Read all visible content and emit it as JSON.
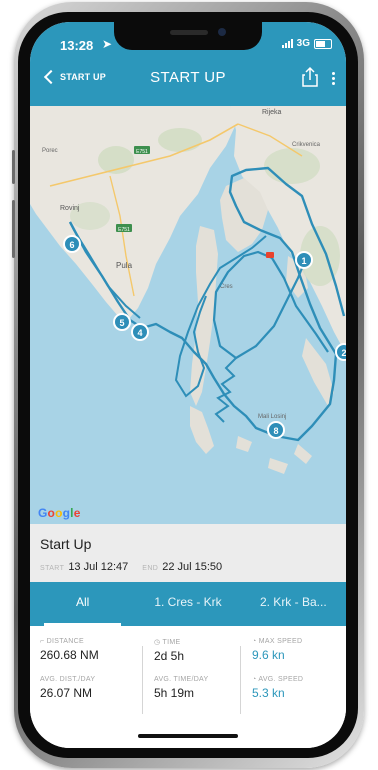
{
  "status": {
    "time": "13:28",
    "signal_label": "3G"
  },
  "header": {
    "back_label": "START UP",
    "title": "START UP"
  },
  "map": {
    "place_labels": [
      "Rijeka",
      "Rovinj",
      "Pula",
      "Cres",
      "Mali Losinj",
      "Porec",
      "Crikvenica"
    ],
    "road_badges": [
      "E751",
      "E751"
    ],
    "waypoints": [
      "1",
      "2",
      "4",
      "5",
      "6",
      "8"
    ],
    "attribution": "Google",
    "route_color": "#2e8eb8"
  },
  "trip": {
    "name": "Start Up",
    "start_label": "START",
    "start_value": "13 Jul 12:47",
    "end_label": "END",
    "end_value": "22 Jul 15:50"
  },
  "tabs": [
    "All",
    "1. Cres - Krk",
    "2. Krk - Ba..."
  ],
  "stats": {
    "distance": {
      "label": "DISTANCE",
      "value": "260.68 NM"
    },
    "time": {
      "label": "TIME",
      "value": "2d 5h"
    },
    "max_speed": {
      "label": "MAX SPEED",
      "value": "9.6 kn"
    },
    "avg_dist": {
      "label": "AVG. DIST./DAY",
      "value": "26.07 NM"
    },
    "avg_time": {
      "label": "AVG. TIME/DAY",
      "value": "5h 19m"
    },
    "avg_speed": {
      "label": "AVG. SPEED",
      "value": "5.3 kn"
    }
  },
  "colors": {
    "accent": "#2c97bb",
    "land": "#e9e6df",
    "sea": "#a8d3e6"
  }
}
